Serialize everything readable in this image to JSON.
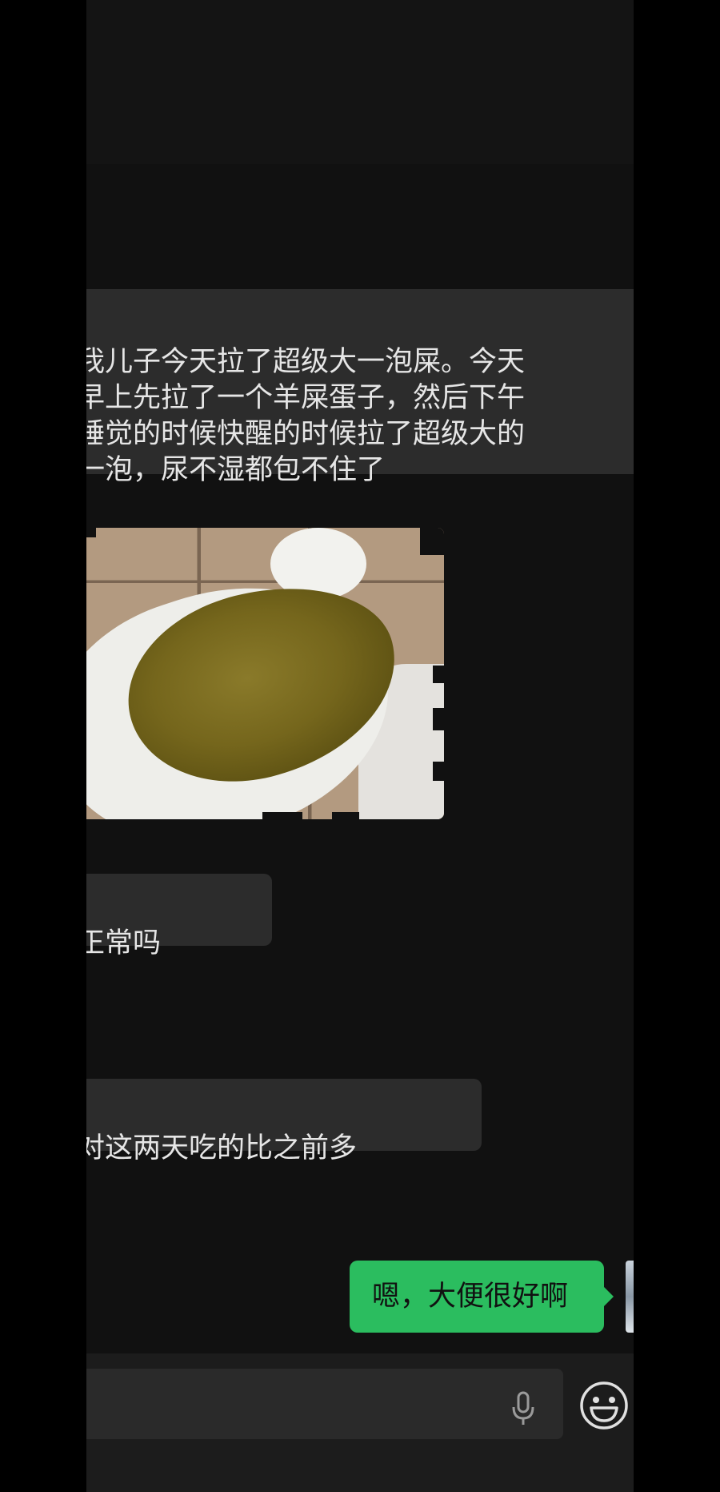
{
  "conversation": {
    "incoming": [
      {
        "text": "我儿子今天拉了超级大一泡屎。今天\n早上先拉了一个羊屎蛋子，然后下午\n睡觉的时候快醒的时候拉了超级大的\n一泡，尿不湿都包不住了"
      },
      {
        "type": "image",
        "description_icon": "photo-message"
      },
      {
        "text": "正常吗"
      },
      {
        "text": "对这两天吃的比之前多"
      }
    ],
    "outgoing": [
      {
        "text": "嗯，大便很好啊"
      }
    ]
  },
  "input_bar": {
    "value": "",
    "voice_icon": "microphone-icon",
    "emoji_icon": "emoji-icon"
  },
  "colors": {
    "background": "#111111",
    "incoming_bubble": "#2c2c2c",
    "outgoing_bubble": "#2bbd5f"
  }
}
